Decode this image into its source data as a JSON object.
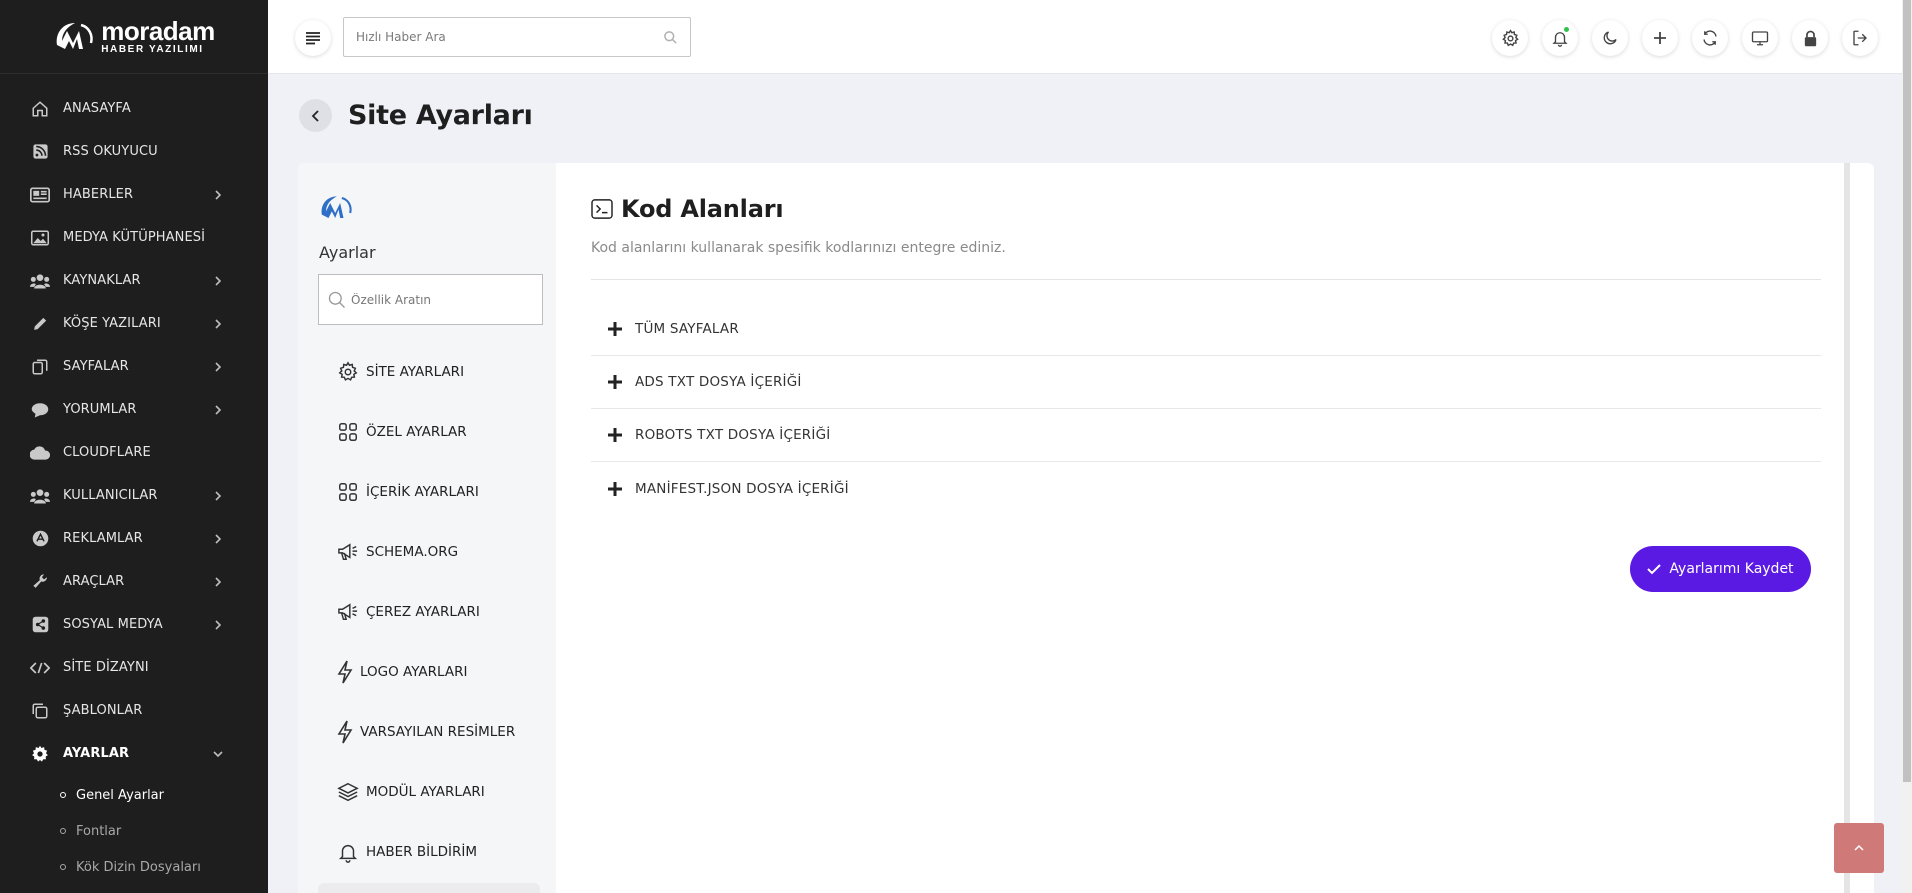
{
  "brand": {
    "name": "moradam",
    "subtitle": "HABER YAZILIMI"
  },
  "sidebar": {
    "items": [
      {
        "label": "ANASAYFA",
        "icon": "home-icon",
        "has_children": false
      },
      {
        "label": "RSS OKUYUCU",
        "icon": "rss-icon",
        "has_children": false
      },
      {
        "label": "HABERLER",
        "icon": "newspaper-icon",
        "has_children": true
      },
      {
        "label": "MEDYA KÜTÜPHANESİ",
        "icon": "image-icon",
        "has_children": false
      },
      {
        "label": "KAYNAKLAR",
        "icon": "users-icon",
        "has_children": true
      },
      {
        "label": "KÖŞE YAZILARI",
        "icon": "pencil-icon",
        "has_children": true
      },
      {
        "label": "SAYFALAR",
        "icon": "pages-icon",
        "has_children": true
      },
      {
        "label": "YORUMLAR",
        "icon": "comment-icon",
        "has_children": true
      },
      {
        "label": "CLOUDFLARE",
        "icon": "cloud-icon",
        "has_children": false
      },
      {
        "label": "KULLANICILAR",
        "icon": "users-icon",
        "has_children": true
      },
      {
        "label": "REKLAMLAR",
        "icon": "ads-icon",
        "has_children": true
      },
      {
        "label": "ARAÇLAR",
        "icon": "wrench-icon",
        "has_children": true
      },
      {
        "label": "SOSYAL MEDYA",
        "icon": "share-icon",
        "has_children": true
      },
      {
        "label": "SİTE DİZAYNI",
        "icon": "code-icon",
        "has_children": false
      },
      {
        "label": "ŞABLONLAR",
        "icon": "copy-icon",
        "has_children": false
      },
      {
        "label": "AYARLAR",
        "icon": "gear-icon",
        "has_children": true,
        "expanded": true
      }
    ],
    "sub_items": [
      {
        "label": "Genel Ayarlar",
        "active": true
      },
      {
        "label": "Fontlar",
        "active": false
      },
      {
        "label": "Kök Dizin Dosyaları",
        "active": false
      }
    ]
  },
  "topbar": {
    "search_placeholder": "Hızlı Haber Ara",
    "icons": [
      "gear-icon",
      "bell-icon",
      "moon-icon",
      "plus-icon",
      "refresh-icon",
      "monitor-icon",
      "lock-icon",
      "logout-icon"
    ]
  },
  "page": {
    "title": "Site Ayarları"
  },
  "settings_nav": {
    "title": "Ayarlar",
    "search_placeholder": "Özellik Aratın",
    "items": [
      {
        "label": "SİTE AYARLARI",
        "icon": "gear-icon"
      },
      {
        "label": "ÖZEL AYARLAR",
        "icon": "grid-icon"
      },
      {
        "label": "İÇERİK AYARLARI",
        "icon": "grid-icon"
      },
      {
        "label": "SCHEMA.ORG",
        "icon": "megaphone-icon"
      },
      {
        "label": "ÇEREZ AYARLARI",
        "icon": "megaphone-icon"
      },
      {
        "label": "LOGO AYARLARI",
        "icon": "bolt-icon"
      },
      {
        "label": "VARSAYILAN RESİMLER",
        "icon": "bolt-icon"
      },
      {
        "label": "MODÜL AYARLARI",
        "icon": "layers-icon"
      },
      {
        "label": "HABER BİLDİRİM",
        "icon": "bell-icon"
      }
    ]
  },
  "content": {
    "title": "Kod Alanları",
    "description": "Kod alanlarını kullanarak spesifik kodlarınızı entegre ediniz.",
    "sections": [
      {
        "label": "TÜM SAYFALAR"
      },
      {
        "label": "ADS TXT DOSYA İÇERİĞİ"
      },
      {
        "label": "ROBOTS TXT DOSYA İÇERİĞİ"
      },
      {
        "label": "MANİFEST.JSON DOSYA İÇERİĞİ"
      }
    ],
    "save_label": "Ayarlarımı Kaydet"
  },
  "colors": {
    "sidebar_bg": "#1e1e1e",
    "accent": "#5b19e4",
    "to_top": "#cf7a78",
    "notif": "#2ec24e"
  }
}
